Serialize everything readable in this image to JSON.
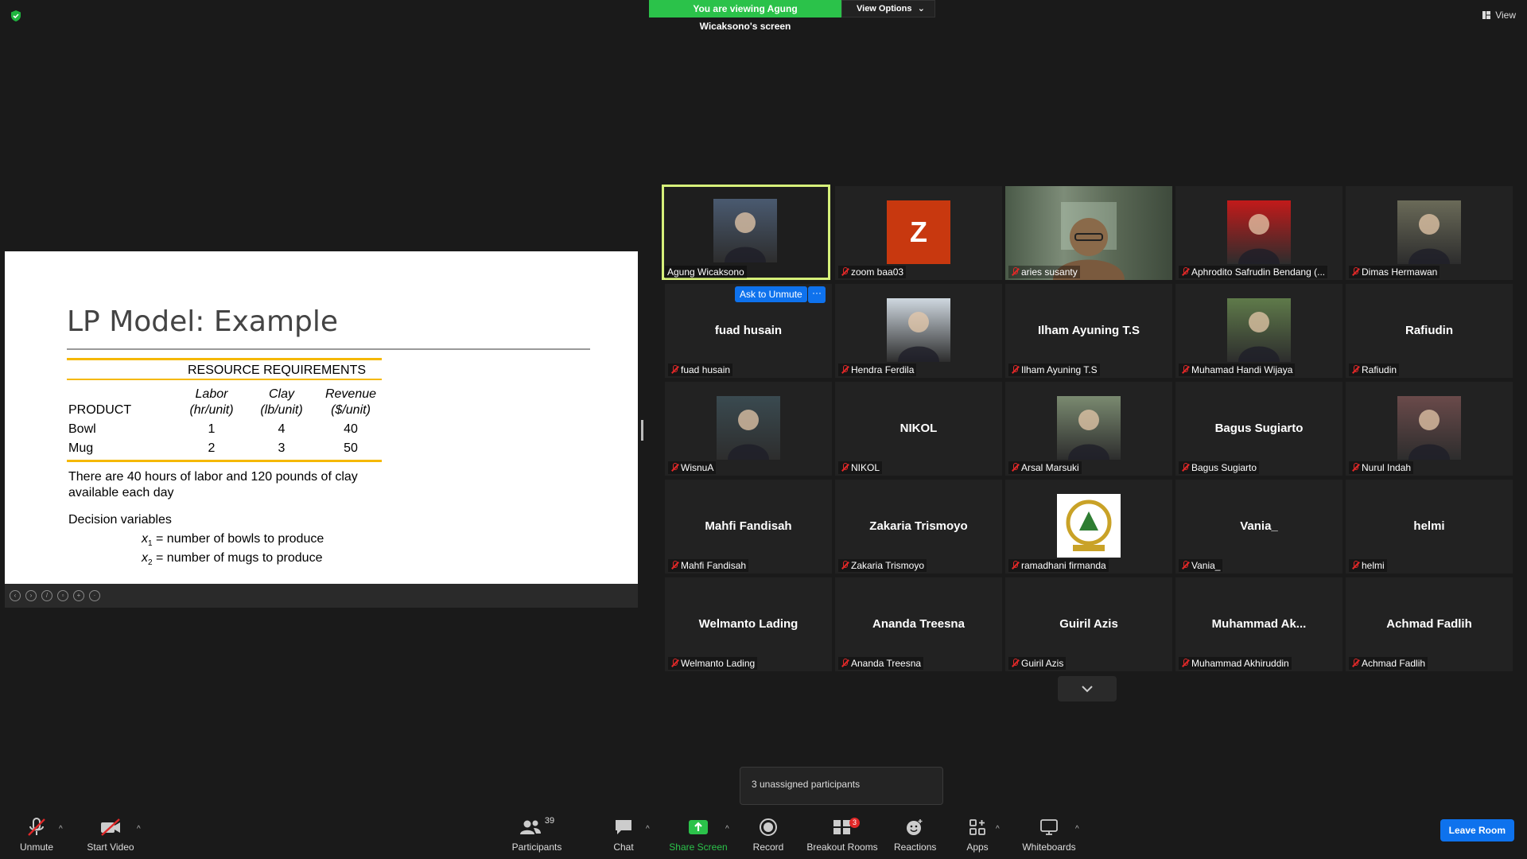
{
  "banner": {
    "viewing": "You are viewing Agung Wicaksono's screen",
    "view_options": "View Options"
  },
  "view_label": "View",
  "slide": {
    "title": "LP Model: Example",
    "table_title": "RESOURCE REQUIREMENTS",
    "headers": {
      "product": "PRODUCT",
      "labor": "Labor",
      "labor_unit": "(hr/unit)",
      "clay": "Clay",
      "clay_unit": "(lb/unit)",
      "revenue": "Revenue",
      "revenue_unit": "($/unit)"
    },
    "rows": [
      {
        "product": "Bowl",
        "labor": "1",
        "clay": "4",
        "revenue": "40"
      },
      {
        "product": "Mug",
        "labor": "2",
        "clay": "3",
        "revenue": "50"
      }
    ],
    "text1": "There are 40 hours of labor and 120 pounds of clay available each day",
    "decision": "Decision variables",
    "x1": "x",
    "x1_sub": "1",
    "x1_text": " = number of bowls to produce",
    "x2": "x",
    "x2_sub": "2",
    "x2_text": " = number of mugs to produce"
  },
  "ask_unmute": "Ask to Unmute",
  "more": "···",
  "participants": [
    {
      "name": "Agung Wicaksono",
      "muted": false,
      "video": "photo",
      "active": true
    },
    {
      "name": "zoom baa03",
      "muted": true,
      "video": "avatar",
      "letter": "Z"
    },
    {
      "name": "aries susanty",
      "muted": true,
      "video": "live"
    },
    {
      "name": "Aphrodito Safrudin Bendang (...",
      "muted": true,
      "video": "photo"
    },
    {
      "name": "Dimas Hermawan",
      "muted": true,
      "video": "photo"
    },
    {
      "name": "fuad husain",
      "muted": true,
      "video": "text",
      "big": "fuad husain"
    },
    {
      "name": "Hendra Ferdila",
      "muted": true,
      "video": "photo"
    },
    {
      "name": "Ilham Ayuning T.S",
      "muted": true,
      "video": "text",
      "big": "Ilham Ayuning T.S"
    },
    {
      "name": "Muhamad Handi Wijaya",
      "muted": true,
      "video": "photo"
    },
    {
      "name": "Rafiudin",
      "muted": true,
      "video": "text",
      "big": "Rafiudin"
    },
    {
      "name": "WisnuA",
      "muted": true,
      "video": "photo"
    },
    {
      "name": "NIKOL",
      "muted": true,
      "video": "text",
      "big": "NIKOL"
    },
    {
      "name": "Arsal Marsuki",
      "muted": true,
      "video": "photo"
    },
    {
      "name": "Bagus Sugiarto",
      "muted": true,
      "video": "text",
      "big": "Bagus Sugiarto"
    },
    {
      "name": "Nurul Indah",
      "muted": true,
      "video": "photo"
    },
    {
      "name": "Mahfi Fandisah",
      "muted": true,
      "video": "text",
      "big": "Mahfi Fandisah"
    },
    {
      "name": "Zakaria Trismoyo",
      "muted": true,
      "video": "text",
      "big": "Zakaria Trismoyo"
    },
    {
      "name": "ramadhani firmanda",
      "muted": true,
      "video": "logo"
    },
    {
      "name": "Vania_",
      "muted": true,
      "video": "text",
      "big": "Vania_"
    },
    {
      "name": "helmi",
      "muted": true,
      "video": "text",
      "big": "helmi"
    },
    {
      "name": "Welmanto Lading",
      "muted": true,
      "video": "text",
      "big": "Welmanto Lading"
    },
    {
      "name": "Ananda Treesna",
      "muted": true,
      "video": "text",
      "big": "Ananda Treesna"
    },
    {
      "name": "Guiril Azis",
      "muted": true,
      "video": "text",
      "big": "Guiril Azis"
    },
    {
      "name": "Muhammad Akhiruddin",
      "muted": true,
      "video": "text",
      "big": "Muhammad  Ak..."
    },
    {
      "name": "Achmad Fadlih",
      "muted": true,
      "video": "text",
      "big": "Achmad Fadlih"
    }
  ],
  "tooltip": "3 unassigned participants",
  "toolbar": {
    "unmute": "Unmute",
    "start_video": "Start Video",
    "participants": "Participants",
    "participants_count": "39",
    "chat": "Chat",
    "share_screen": "Share Screen",
    "record": "Record",
    "breakout_rooms": "Breakout Rooms",
    "breakout_badge": "3",
    "reactions": "Reactions",
    "apps": "Apps",
    "whiteboards": "Whiteboards",
    "leave_room": "Leave Room"
  },
  "colors": {
    "accent": "#0e72ed",
    "share_green": "#2bc24a",
    "active_border": "#d6f07a",
    "avatar_orange": "#c8380f",
    "mute_red": "#e02828",
    "slide_yellow": "#f5b800"
  }
}
